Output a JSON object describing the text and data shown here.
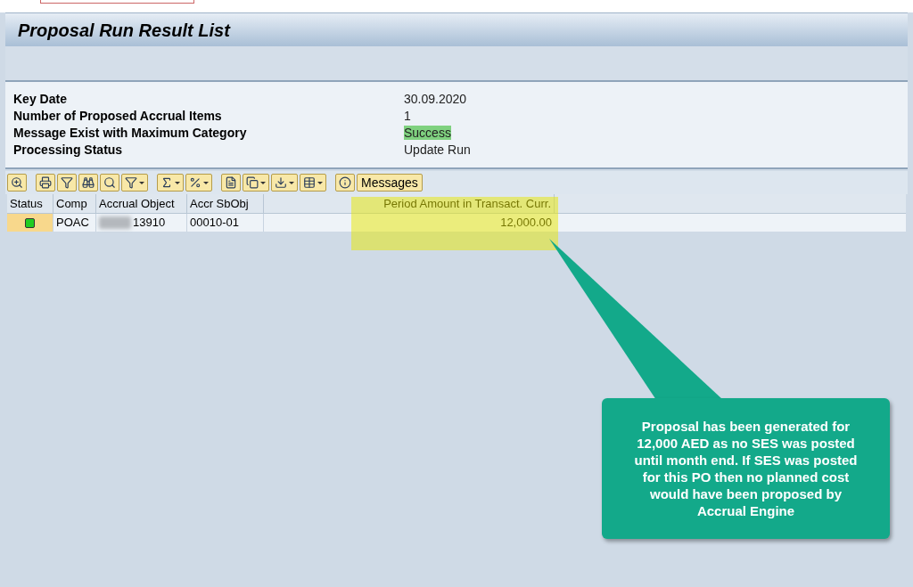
{
  "window": {
    "title": "Proposal Run Result List"
  },
  "header_info": [
    {
      "label": "Key Date",
      "value": "30.09.2020",
      "highlighted": false
    },
    {
      "label": "Number of Proposed Accrual Items",
      "value": "1",
      "highlighted": false
    },
    {
      "label": "Message Exist with Maximum Category",
      "value": "Success",
      "highlighted": true
    },
    {
      "label": "Processing Status",
      "value": "Update Run",
      "highlighted": false
    }
  ],
  "toolbar": {
    "messages_button": "Messages"
  },
  "table": {
    "columns": [
      "Status",
      "Comp",
      "Accrual Object",
      "Accr SbObj",
      "Period Amount in Transact. Curr."
    ],
    "rows": [
      {
        "color": "#22cc22",
        "comp": "POAC",
        "accrual_object": "13910",
        "accr_sbobj": "00010-01",
        "amount": "12,000.00"
      }
    ]
  },
  "annotation": {
    "text": "Proposal has been generated for 12,000 AED as no SES was posted until month end. If SES was posted for this PO then no planned cost would have been proposed by Accrual Engine"
  }
}
